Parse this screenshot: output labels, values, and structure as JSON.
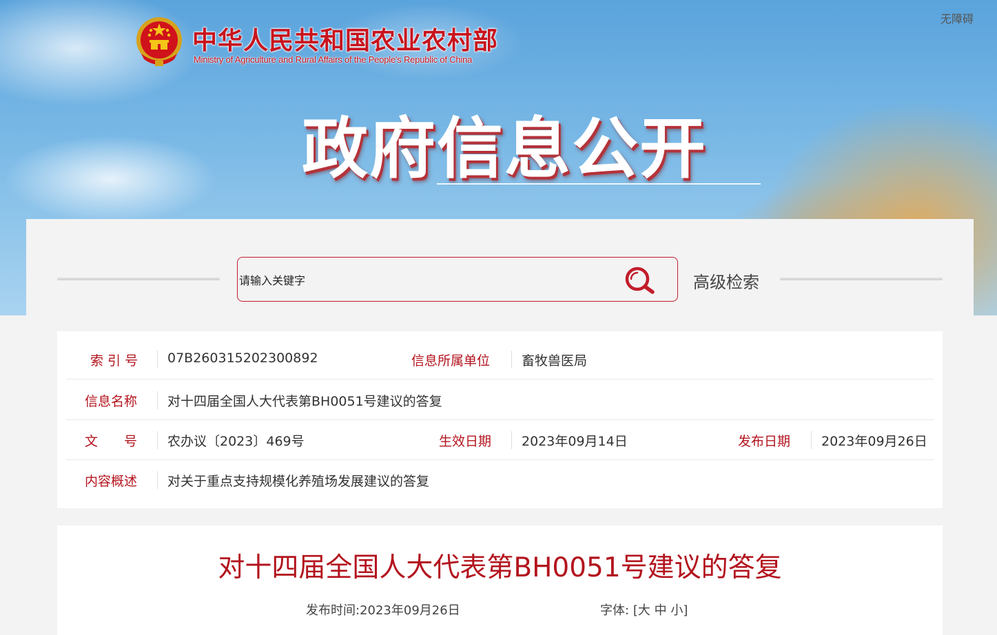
{
  "header": {
    "logo_cn": "中华人民共和国农业农村部",
    "logo_en": "Ministry of Agriculture and Rural Affairs of the People's Republic of China",
    "accessibility": "无障碍",
    "section_title": "政府信息公开"
  },
  "search": {
    "placeholder": "请输入关键字",
    "advanced_label": "高级检索"
  },
  "info": {
    "index_label": "索 引 号",
    "index_value": "07B260315202300892",
    "unit_label": "信息所属单位",
    "unit_value": "畜牧兽医局",
    "name_label": "信息名称",
    "name_value": "对十四届全国人大代表第BH0051号建议的答复",
    "doc_label": "文　　号",
    "doc_value": "农办议〔2023〕469号",
    "effective_label": "生效日期",
    "effective_value": "2023年09月14日",
    "publish_label": "发布日期",
    "publish_value": "2023年09月26日",
    "summary_label": "内容概述",
    "summary_value": "对关于重点支持规模化养殖场发展建议的答复"
  },
  "article": {
    "title": "对十四届全国人大代表第BH0051号建议的答复",
    "publish_time_label": "发布时间:",
    "publish_time": "2023年09月26日",
    "font_label": "字体:",
    "font_open": "[",
    "font_large": "大",
    "font_medium": "中",
    "font_small": "小",
    "font_close": "]"
  },
  "colors": {
    "brand_red": "#b3141e",
    "search_border": "#c21d2b"
  },
  "icons": [
    "national-emblem-icon",
    "search-icon"
  ]
}
